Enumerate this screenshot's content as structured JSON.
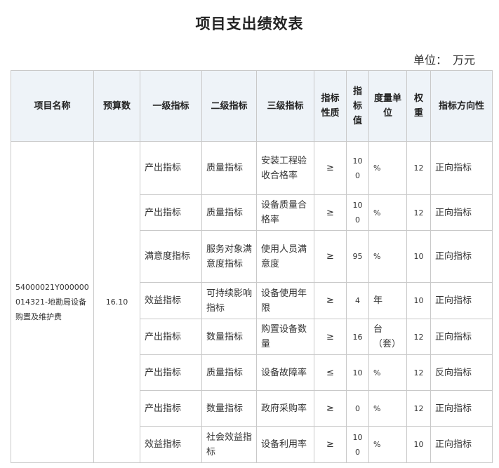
{
  "title": "项目支出绩效表",
  "unit": {
    "label": "单位：",
    "value": "万元"
  },
  "headers": [
    "项目名称",
    "预算数",
    "一级指标",
    "二级指标",
    "三级指标",
    "指标性质",
    "指标值",
    "度量单位",
    "权重",
    "指标方向性"
  ],
  "project": {
    "name": "54000021Y000000014321-地勘局设备购置及维护费",
    "budget": "16.10"
  },
  "rows": [
    {
      "level1": "产出指标",
      "level2": "质量指标",
      "level3": "安装工程验收合格率",
      "nature": "≥",
      "value": "100",
      "unit": "%",
      "weight": "12",
      "direction": "正向指标"
    },
    {
      "level1": "产出指标",
      "level2": "质量指标",
      "level3": "设备质量合格率",
      "nature": "≥",
      "value": "100",
      "unit": "%",
      "weight": "12",
      "direction": "正向指标"
    },
    {
      "level1": "满意度指标",
      "level2": "服务对象满意度指标",
      "level3": "使用人员满意度",
      "nature": "≥",
      "value": "95",
      "unit": "%",
      "weight": "10",
      "direction": "正向指标"
    },
    {
      "level1": "效益指标",
      "level2": "可持续影响指标",
      "level3": "设备使用年限",
      "nature": "≥",
      "value": "4",
      "unit": "年",
      "weight": "10",
      "direction": "正向指标"
    },
    {
      "level1": "产出指标",
      "level2": "数量指标",
      "level3": "购置设备数量",
      "nature": "≥",
      "value": "16",
      "unit": "台（套）",
      "weight": "12",
      "direction": "正向指标"
    },
    {
      "level1": "产出指标",
      "level2": "质量指标",
      "level3": "设备故障率",
      "nature": "≤",
      "value": "10",
      "unit": "%",
      "weight": "12",
      "direction": "反向指标"
    },
    {
      "level1": "产出指标",
      "level2": "数量指标",
      "level3": "政府采购率",
      "nature": "≥",
      "value": "0",
      "unit": "%",
      "weight": "12",
      "direction": "正向指标"
    },
    {
      "level1": "效益指标",
      "level2": "社会效益指标",
      "level3": "设备利用率",
      "nature": "≥",
      "value": "100",
      "unit": "%",
      "weight": "10",
      "direction": "正向指标"
    }
  ]
}
